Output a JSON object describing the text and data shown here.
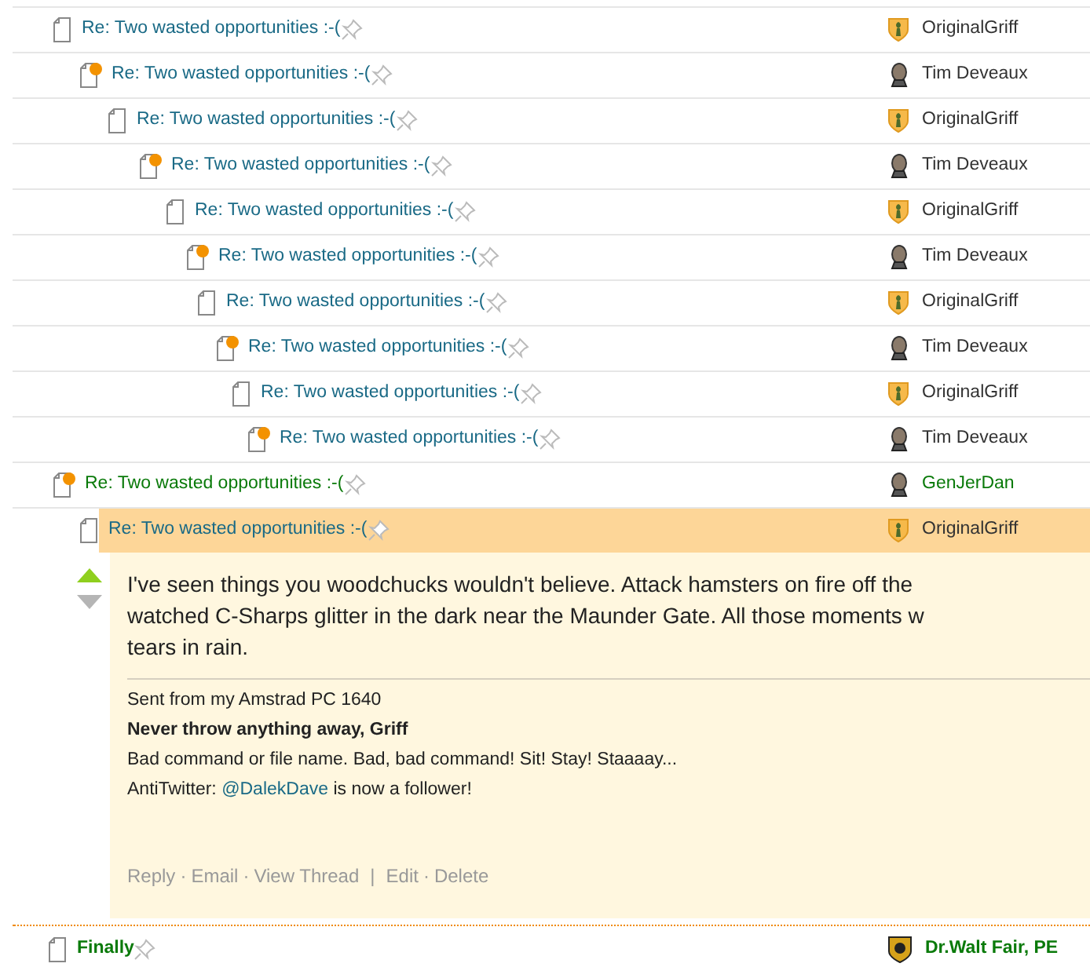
{
  "messages": [
    {
      "subject": "Re: Two wasted opportunities :-(",
      "new": false,
      "color": "#1a6a86",
      "author": "OriginalGriff",
      "kind": "shield",
      "author_colored": false,
      "selected": false,
      "emphasized": false,
      "children": [
        {
          "subject": "Re: Two wasted opportunities :-(",
          "new": true,
          "color": "#1a6a86",
          "author": "Tim Deveaux",
          "kind": "bust",
          "author_colored": false,
          "selected": false,
          "emphasized": false,
          "children": [
            {
              "subject": "Re: Two wasted opportunities :-(",
              "new": false,
              "color": "#1a6a86",
              "author": "OriginalGriff",
              "kind": "shield",
              "author_colored": false,
              "selected": false,
              "emphasized": false,
              "children": [
                {
                  "subject": "Re: Two wasted opportunities :-(",
                  "new": true,
                  "color": "#1a6a86",
                  "author": "Tim Deveaux",
                  "kind": "bust",
                  "author_colored": false,
                  "selected": false,
                  "emphasized": false,
                  "children": [
                    {
                      "subject": "Re: Two wasted opportunities :-(",
                      "new": false,
                      "color": "#1a6a86",
                      "author": "OriginalGriff",
                      "kind": "shield",
                      "author_colored": false,
                      "selected": false,
                      "emphasized": false,
                      "children": [
                        {
                          "subject": "Re: Two wasted opportunities :-(",
                          "new": true,
                          "color": "#1a6a86",
                          "author": "Tim Deveaux",
                          "kind": "bust",
                          "author_colored": false,
                          "selected": false,
                          "emphasized": false,
                          "children": [
                            {
                              "subject": "Re: Two wasted opportunities :-(",
                              "new": false,
                              "color": "#1a6a86",
                              "author": "OriginalGriff",
                              "kind": "shield",
                              "author_colored": false,
                              "selected": false,
                              "emphasized": false,
                              "children": [
                                {
                                  "subject": "Re: Two wasted opportunities :-(",
                                  "new": true,
                                  "color": "#1a6a86",
                                  "author": "Tim Deveaux",
                                  "kind": "bust",
                                  "author_colored": false,
                                  "selected": false,
                                  "emphasized": false,
                                  "children": [
                                    {
                                      "subject": "Re: Two wasted opportunities :-(",
                                      "new": false,
                                      "color": "#1a6a86",
                                      "author": "OriginalGriff",
                                      "kind": "shield",
                                      "author_colored": false,
                                      "selected": false,
                                      "emphasized": false,
                                      "children": [
                                        {
                                          "subject": "Re: Two wasted opportunities :-(",
                                          "new": true,
                                          "color": "#1a6a86",
                                          "author": "Tim Deveaux",
                                          "kind": "bust",
                                          "author_colored": false,
                                          "selected": false,
                                          "emphasized": false
                                        }
                                      ]
                                    }
                                  ]
                                }
                              ]
                            }
                          ]
                        }
                      ]
                    }
                  ]
                }
              ]
            }
          ]
        }
      ]
    },
    {
      "subject": "Re: Two wasted opportunities :-(",
      "new": true,
      "color": "#0a7a0a",
      "author": "GenJerDan",
      "kind": "bust",
      "author_colored": true,
      "selected": false,
      "emphasized": false,
      "children": [
        {
          "subject": "Re: Two wasted opportunities :-(",
          "new": false,
          "color": "#1a6a86",
          "author": "OriginalGriff",
          "kind": "shield",
          "author_colored": false,
          "selected": true,
          "emphasized": false,
          "body": {
            "lines": [
              "I've seen things you woodchucks wouldn't believe. Attack hamsters on fire off the",
              "watched C-Sharps glitter in the dark near the Maunder Gate. All those moments w",
              "tears in rain."
            ],
            "signature": [
              {
                "kind": "plain",
                "text": "Sent from my Amstrad PC 1640"
              },
              {
                "kind": "bold",
                "text": "Never throw anything away, Griff"
              },
              {
                "kind": "plain",
                "text": "Bad command or file name. Bad, bad command! Sit! Stay! Staaaay..."
              },
              {
                "kind": "mention",
                "before": "AntiTwitter: ",
                "link": "@DalekDave",
                "after": " is now a follower!"
              }
            ],
            "actions": [
              {
                "kind": "link",
                "text": "Reply"
              },
              {
                "kind": "dot",
                "text": "·"
              },
              {
                "kind": "link",
                "text": "Email"
              },
              {
                "kind": "dot",
                "text": "·"
              },
              {
                "kind": "link",
                "text": "View Thread"
              },
              {
                "kind": "bar",
                "text": "|"
              },
              {
                "kind": "link",
                "text": "Edit"
              },
              {
                "kind": "dot",
                "text": "·"
              },
              {
                "kind": "link",
                "text": "Delete"
              }
            ]
          }
        }
      ]
    }
  ],
  "next_thread": {
    "subject": "Finally",
    "new": false,
    "color": "#0a7a0a",
    "author": "Dr.Walt Fair, PE",
    "kind": "medal",
    "author_colored": true,
    "selected": false,
    "emphasized": true
  }
}
